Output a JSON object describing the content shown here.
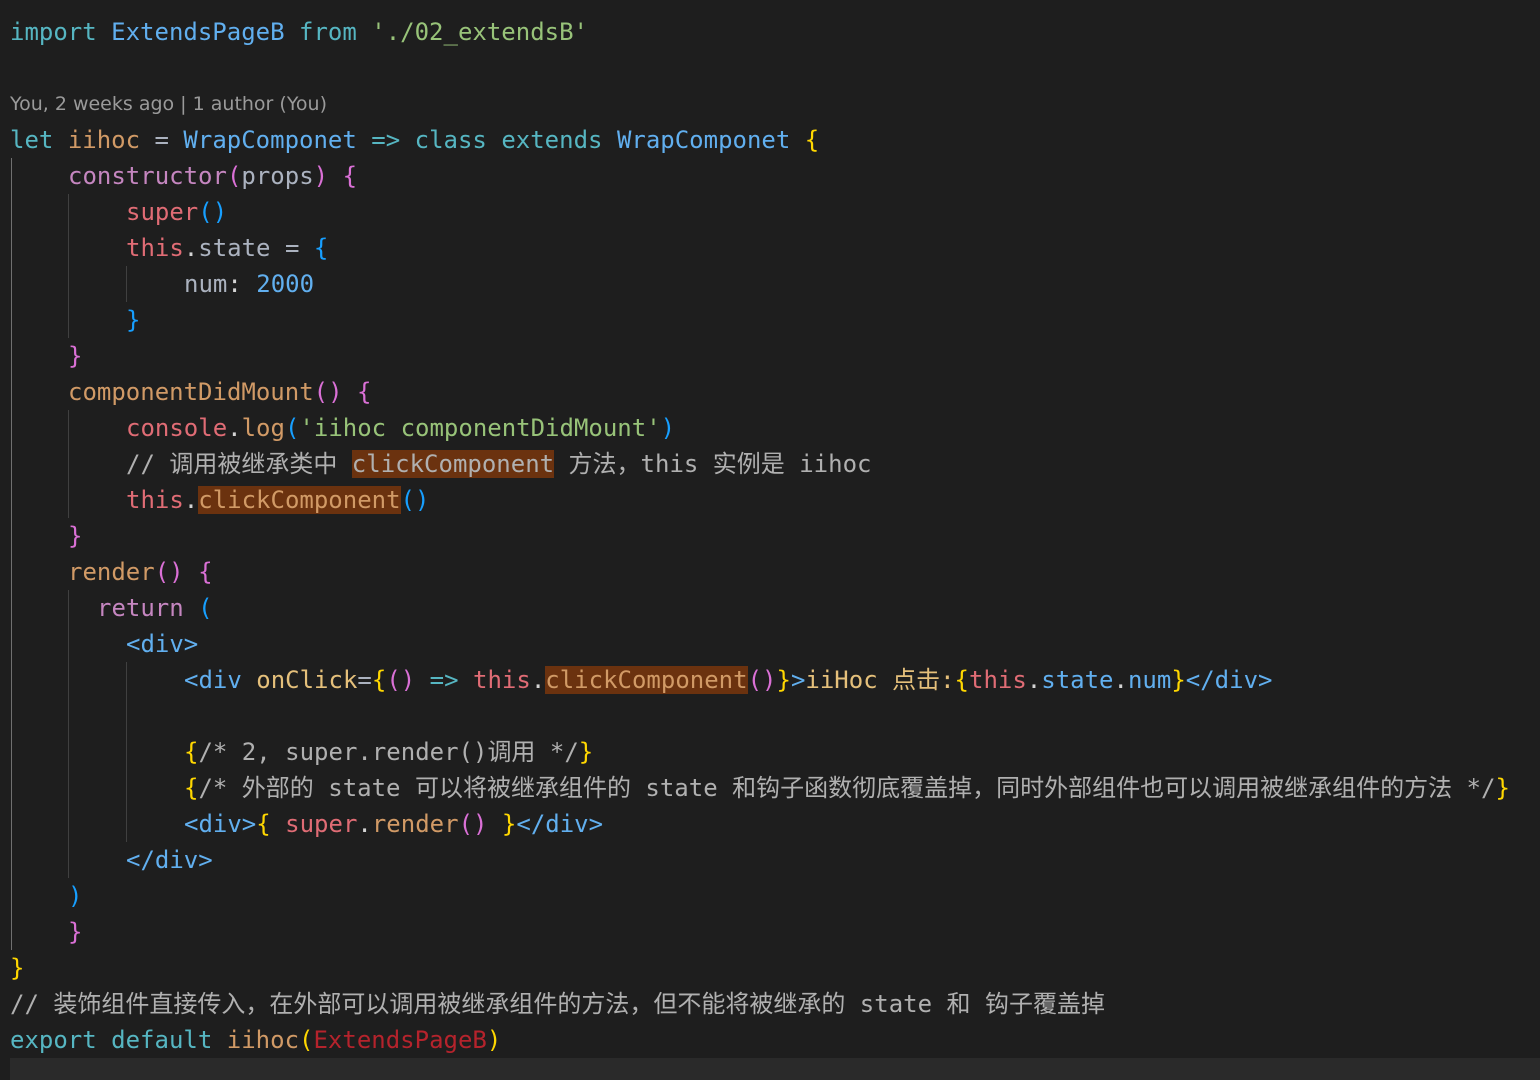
{
  "codelens": "You, 2 weeks ago | 1 author (You)",
  "code": {
    "l1": {
      "import_kw": "import",
      "name": "ExtendsPageB",
      "from_kw": "from",
      "path": "'./02_extendsB'"
    },
    "l3": {
      "let_kw": "let",
      "name": "iihoc",
      "eq": "=",
      "param": "WrapComponet",
      "arrow": "=>",
      "class_kw": "class",
      "extends_kw": "extends",
      "base": "WrapComponet",
      "brace": "{"
    },
    "l4": {
      "fn": "constructor",
      "open": "(",
      "param": "props",
      "close": ")",
      "brace": "{"
    },
    "l5": {
      "super": "super",
      "parens": "()"
    },
    "l6": {
      "this": "this",
      "dot": ".",
      "prop": "state",
      "eq": "=",
      "brace": "{"
    },
    "l7": {
      "key": "num",
      "colon": ":",
      "value": "2000"
    },
    "l8": {
      "close": "}"
    },
    "l9": {
      "close": "}"
    },
    "l10": {
      "fn": "componentDidMount",
      "parens": "()",
      "brace": "{"
    },
    "l11": {
      "obj": "console",
      "dot": ".",
      "method": "log",
      "open": "(",
      "str": "'iihoc componentDidMount'",
      "close": ")"
    },
    "l12": {
      "prefix": "// 调用被继承类中 ",
      "highlight": "clickComponent",
      "suffix": " 方法，this 实例是 iihoc"
    },
    "l13": {
      "this": "this",
      "dot": ".",
      "method": "clickComponent",
      "parens": "()"
    },
    "l14": {
      "close": "}"
    },
    "l15": {
      "fn": "render",
      "parens": "()",
      "brace": "{"
    },
    "l16": {
      "kw": "return",
      "open": "("
    },
    "l17": {
      "tag": "<div>"
    },
    "l18": {
      "tag_open": "<div",
      "attr": "onClick",
      "eq": "=",
      "b_open": "{",
      "arrow_parens": "()",
      "arrow": "=>",
      "this": "this",
      "dot": ".",
      "method": "clickComponent",
      "call": "()",
      "b_close": "}",
      "gt": ">",
      "text": "iiHoc 点击:",
      "e_open": "{",
      "this2": "this",
      "dot2": ".",
      "state": "state",
      "dot3": ".",
      "num": "num",
      "e_close": "}",
      "end_tag": "</div>"
    },
    "l20": {
      "open": "{",
      "comment": "/* 2, super.render()调用 */",
      "close": "}"
    },
    "l21": {
      "open": "{",
      "comment": "/* 外部的 state 可以将被继承组件的 state 和钩子函数彻底覆盖掉，同时外部组件也可以调用被继承组件的方法 */",
      "close": "}"
    },
    "l22": {
      "tag": "<div>",
      "b_open": "{",
      "super": "super",
      "dot": ".",
      "method": "render",
      "parens": "()",
      "b_close": "}",
      "end_tag": "</div>"
    },
    "l23": {
      "end_tag": "</div>"
    },
    "l24": {
      "close": ")"
    },
    "l25": {
      "close": "}"
    },
    "l26": {
      "close": "}"
    },
    "l27": {
      "comment": "// 装饰组件直接传入，在外部可以调用被继承组件的方法，但不能将被继承的 state 和 钩子覆盖掉"
    },
    "l28": {
      "export_kw": "export",
      "default_kw": "default",
      "fn": "iihoc",
      "open": "(",
      "arg": "ExtendsPageB",
      "close": ")"
    }
  }
}
